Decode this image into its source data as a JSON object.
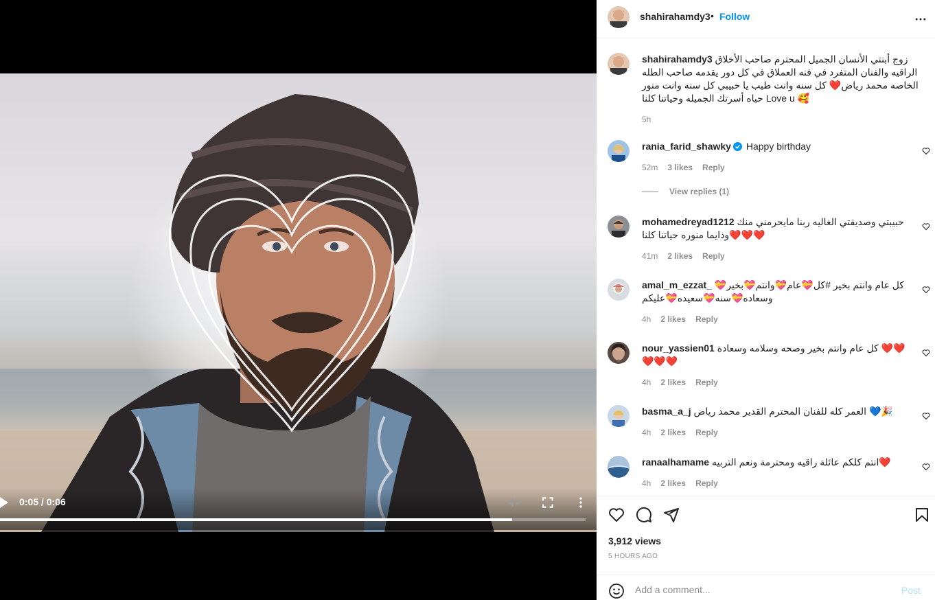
{
  "video": {
    "time": "0:05 / 0:06",
    "progress": 0.875
  },
  "header": {
    "username": "shahirahamdy3",
    "dot": "•",
    "follow_label": "Follow"
  },
  "caption": {
    "username": "shahirahamdy3",
    "text": "زوج أبنتي الأنسان الجميل المحترم صاحب الأخلاق الراقيه والفنان المتفرد في فنه العملاق في كل دور يقدمه صاحب الطله الخاصه محمد رياض❤️ كل سنه وانت طيب يا حبيبي كل سنه وانت منور حياه أسرتك الجميله وحياتنا كلنا Love u 🥰",
    "time": "5h"
  },
  "comments": [
    {
      "username": "rania_farid_shawky",
      "verified": true,
      "text": "Happy birthday",
      "time": "52m",
      "likes": "3 likes",
      "reply": "Reply",
      "view_replies": "View replies (1)"
    },
    {
      "username": "mohamedreyad1212",
      "verified": false,
      "text": "حبيبتي وصديقتي الغاليه ربنا مايحرمني منك ❤️❤️❤️ودايما منوره حياتنا كلنا",
      "time": "41m",
      "likes": "2 likes",
      "reply": "Reply"
    },
    {
      "username": "amal_m_ezzat_",
      "verified": false,
      "text": "كل عام وانتم بخير #كل💝عام💝وانتم💝بخير💝 وسعاده💝سنه💝سعيده💝عليكم",
      "time": "4h",
      "likes": "2 likes",
      "reply": "Reply"
    },
    {
      "username": "nour_yassien01",
      "verified": false,
      "text": "كل عام وانتم بخير وصحه وسلامه وسعادة ❤️❤️ ❤️❤️❤️",
      "time": "4h",
      "likes": "2 likes",
      "reply": "Reply"
    },
    {
      "username": "basma_a_j",
      "verified": false,
      "text": "العمر كله للفنان المحترم القدير محمد رياض 💙🎉",
      "time": "4h",
      "likes": "2 likes",
      "reply": "Reply"
    },
    {
      "username": "ranaalhamame",
      "verified": false,
      "text": "انتم كلكم عائلة راقيه ومحترمة ونعم التربيه❤️",
      "time": "4h",
      "likes": "2 likes",
      "reply": "Reply"
    }
  ],
  "footer": {
    "views": "3,912 views",
    "age": "5 HOURS AGO",
    "comment_placeholder": "Add a comment...",
    "post_label": "Post"
  },
  "colors": {
    "accent": "#0095f6",
    "post_disabled": "#b2dffc",
    "heart_red": "#ed4956",
    "meta_gray": "#8e8e8e"
  }
}
